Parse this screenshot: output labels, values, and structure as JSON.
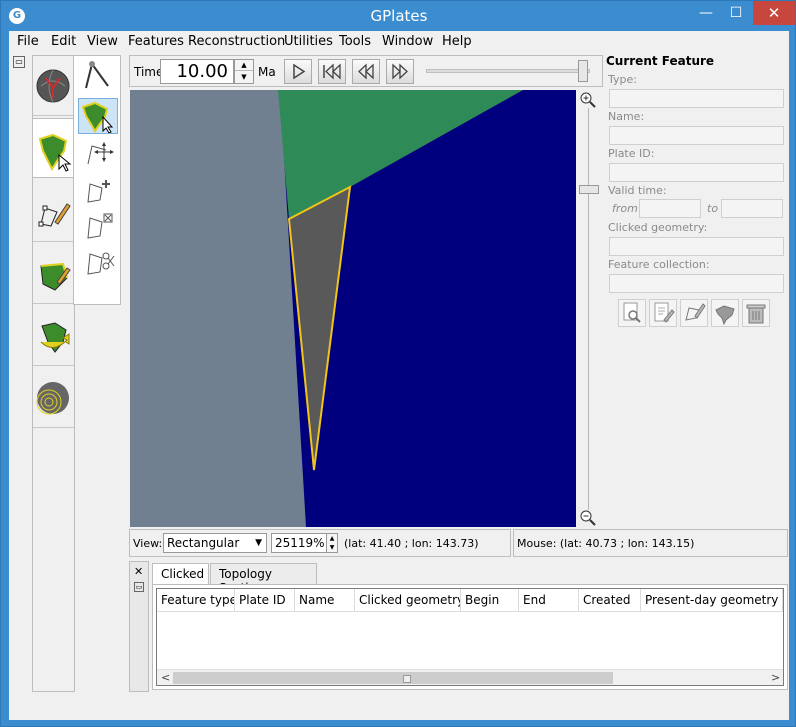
{
  "window": {
    "title": "GPlates",
    "app_icon": "gplates-logo-icon",
    "controls": [
      "minimize",
      "maximize",
      "close"
    ]
  },
  "menu": [
    "File",
    "Edit",
    "View",
    "Features",
    "Reconstruction",
    "Utilities",
    "Tools",
    "Window",
    "Help"
  ],
  "toolbox": {
    "tabs": [
      "globe-view-tool-icon",
      "feature-inspection-tool-icon",
      "digitisation-tool-icon",
      "topology-tool-icon",
      "pole-manipulation-tool-icon",
      "small-circle-tool-icon"
    ],
    "sub_tools": [
      "measure-distance-icon",
      "choose-feature-icon",
      "move-vertex-icon",
      "insert-vertex-icon",
      "delete-vertex-icon",
      "split-feature-icon"
    ]
  },
  "animation": {
    "time_label": "Time:",
    "time_value": "10.00",
    "unit": "Ma",
    "buttons": [
      "play-icon",
      "rewind-to-start-icon",
      "step-back-icon",
      "step-forward-icon"
    ],
    "slider_position": 0.94
  },
  "map": {
    "colors": {
      "ocean": "#00007f",
      "grey_plate": "#708090",
      "green_plate": "#2e8b57",
      "selected_polygon": "#595959",
      "highlight": "#f0c419"
    }
  },
  "viewbar": {
    "view_label": "View:",
    "projection": "Rectangular",
    "zoom": "25119%",
    "camera_latlon": "(lat: 41.40 ; lon: 143.73)"
  },
  "mouse": {
    "text": "Mouse: (lat: 40.73 ; lon: 143.15)"
  },
  "feature_panel": {
    "title": "Current Feature",
    "fields": {
      "type": "Type:",
      "name": "Name:",
      "plate_id": "Plate ID:",
      "valid_time": "Valid time:",
      "from": "from",
      "to": "to",
      "clicked_geometry": "Clicked geometry:",
      "feature_collection": "Feature collection:"
    },
    "actions": [
      "query-feature-icon",
      "edit-feature-icon",
      "clone-geometry-icon",
      "clone-feature-icon",
      "delete-feature-icon"
    ]
  },
  "lower_dock": {
    "tabs": [
      "Clicked",
      "Topology Sections"
    ],
    "columns": [
      "Feature type",
      "Plate ID",
      "Name",
      "Clicked geometry",
      "Begin",
      "End",
      "Created",
      "Present-day geometry (lat"
    ]
  }
}
